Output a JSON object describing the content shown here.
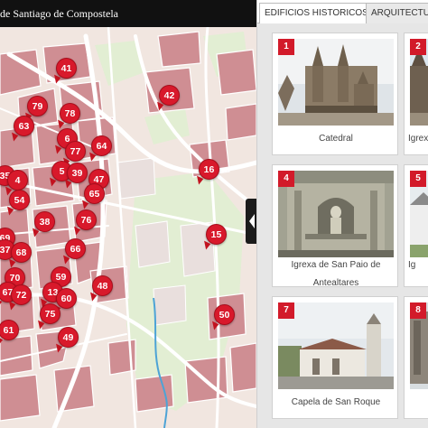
{
  "map": {
    "title": "de Santiago de Compostela",
    "colors": {
      "header": "#111111",
      "marker": "#d8192b",
      "block": "#c9868b",
      "road": "#ffffff",
      "park": "#dfeed0",
      "river": "#4da3d6"
    },
    "markers": [
      {
        "num": "41"
      },
      {
        "num": "42"
      },
      {
        "num": "79"
      },
      {
        "num": "78"
      },
      {
        "num": "63"
      },
      {
        "num": "6"
      },
      {
        "num": "77"
      },
      {
        "num": "64"
      },
      {
        "num": "16"
      },
      {
        "num": "35"
      },
      {
        "num": "5"
      },
      {
        "num": "39"
      },
      {
        "num": "47"
      },
      {
        "num": "4"
      },
      {
        "num": "65"
      },
      {
        "num": "54"
      },
      {
        "num": "38"
      },
      {
        "num": "76"
      },
      {
        "num": "15"
      },
      {
        "num": "69"
      },
      {
        "num": "37"
      },
      {
        "num": "68"
      },
      {
        "num": "66"
      },
      {
        "num": "70"
      },
      {
        "num": "59"
      },
      {
        "num": "48"
      },
      {
        "num": "67"
      },
      {
        "num": "72"
      },
      {
        "num": "13"
      },
      {
        "num": "60"
      },
      {
        "num": "75"
      },
      {
        "num": "50"
      },
      {
        "num": "61"
      },
      {
        "num": "49"
      }
    ]
  },
  "panel": {
    "tabs": [
      "EDIFICIOS HISTORICOS",
      "ARQUITECTU"
    ],
    "cards": [
      {
        "num": "1",
        "caption": [
          "Catedral"
        ]
      },
      {
        "num": "2",
        "caption": [
          "Igrex"
        ]
      },
      {
        "num": "4",
        "caption": [
          "Igrexa de San Paio de",
          "Antealtares"
        ]
      },
      {
        "num": "5",
        "caption": [
          "Ig"
        ]
      },
      {
        "num": "7",
        "caption": [
          "Capela de San Roque"
        ]
      },
      {
        "num": "8",
        "caption": [
          ""
        ]
      }
    ]
  }
}
